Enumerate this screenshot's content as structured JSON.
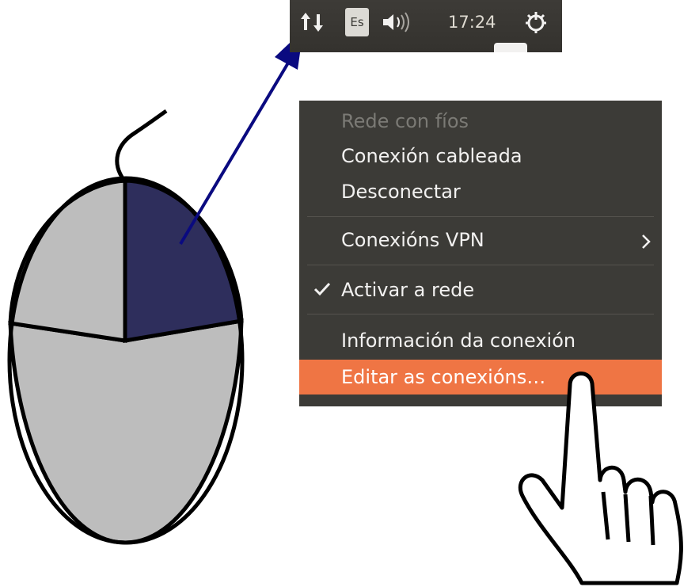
{
  "topbar": {
    "keyboard_layout": "Es",
    "clock": "17:24",
    "icons": [
      "network-updown-icon",
      "volume-icon",
      "session-gear-icon"
    ]
  },
  "menu": {
    "items": [
      {
        "label": "Rede con fíos",
        "disabled": true
      },
      {
        "label": "Conexión cableada"
      },
      {
        "label": "Desconectar"
      },
      {
        "label": "Conexións VPN",
        "submenu": true
      },
      {
        "label": "Activar a rede",
        "checked": true
      },
      {
        "label": "Información da conexión"
      },
      {
        "label": "Editar as conexións…",
        "highlighted": true
      }
    ]
  },
  "colors": {
    "panel_bg": "#3c3b37",
    "highlight": "#ef7544",
    "mouse_body": "#bdbdbd",
    "mouse_right_button": "#2e2e5c",
    "pointer_arrow": "#0a0a80"
  }
}
